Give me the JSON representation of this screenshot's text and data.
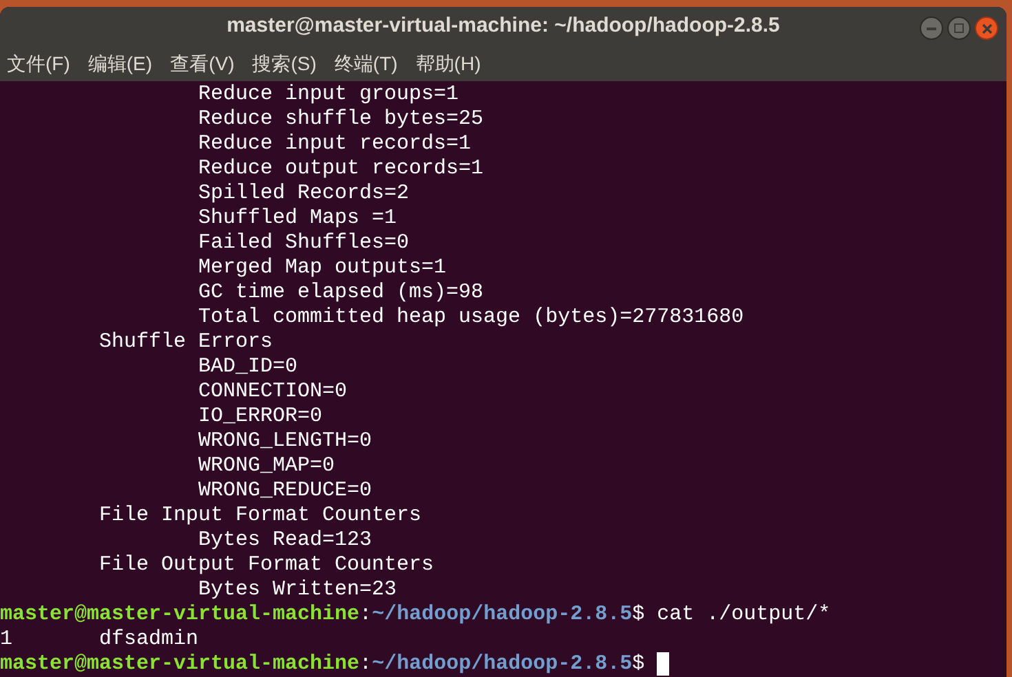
{
  "window": {
    "title": "master@master-virtual-machine: ~/hadoop/hadoop-2.8.5"
  },
  "menu": [
    "文件(F)",
    "编辑(E)",
    "查看(V)",
    "搜索(S)",
    "终端(T)",
    "帮助(H)"
  ],
  "lines": [
    {
      "kind": "output",
      "text": "                Reduce input groups=1"
    },
    {
      "kind": "output",
      "text": "                Reduce shuffle bytes=25"
    },
    {
      "kind": "output",
      "text": "                Reduce input records=1"
    },
    {
      "kind": "output",
      "text": "                Reduce output records=1"
    },
    {
      "kind": "output",
      "text": "                Spilled Records=2"
    },
    {
      "kind": "output",
      "text": "                Shuffled Maps =1"
    },
    {
      "kind": "output",
      "text": "                Failed Shuffles=0"
    },
    {
      "kind": "output",
      "text": "                Merged Map outputs=1"
    },
    {
      "kind": "output",
      "text": "                GC time elapsed (ms)=98"
    },
    {
      "kind": "output",
      "text": "                Total committed heap usage (bytes)=277831680"
    },
    {
      "kind": "output",
      "text": "        Shuffle Errors"
    },
    {
      "kind": "output",
      "text": "                BAD_ID=0"
    },
    {
      "kind": "output",
      "text": "                CONNECTION=0"
    },
    {
      "kind": "output",
      "text": "                IO_ERROR=0"
    },
    {
      "kind": "output",
      "text": "                WRONG_LENGTH=0"
    },
    {
      "kind": "output",
      "text": "                WRONG_MAP=0"
    },
    {
      "kind": "output",
      "text": "                WRONG_REDUCE=0"
    },
    {
      "kind": "output",
      "text": "        File Input Format Counters"
    },
    {
      "kind": "output",
      "text": "                Bytes Read=123"
    },
    {
      "kind": "output",
      "text": "        File Output Format Counters"
    },
    {
      "kind": "output",
      "text": "                Bytes Written=23"
    },
    {
      "kind": "prompt",
      "user": "master@master-virtual-machine",
      "separator": ":",
      "path": "~/hadoop/hadoop-2.8.5",
      "symbol": "$",
      "command": "cat ./output/*",
      "cursor": false
    },
    {
      "kind": "output",
      "text": "1       dfsadmin"
    },
    {
      "kind": "prompt",
      "user": "master@master-virtual-machine",
      "separator": ":",
      "path": "~/hadoop/hadoop-2.8.5",
      "symbol": "$",
      "cursor": true
    }
  ]
}
